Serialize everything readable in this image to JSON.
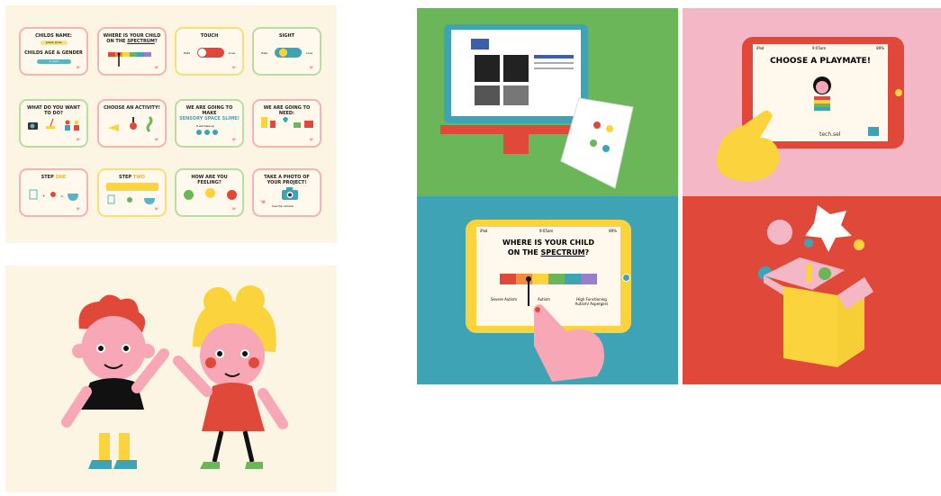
{
  "wireframe": {
    "cards": [
      {
        "title": "CHILDS NAME:",
        "subtitle": "CHILDS AGE & GENDER",
        "field1": "Jessie Jones",
        "field2": "4 years"
      },
      {
        "title_line1": "WHERE IS YOUR CHILD",
        "title_line2_prefix": "ON THE ",
        "title_line2_highlight": "SPECTRUM",
        "title_line2_suffix": "?"
      },
      {
        "title": "TOUCH",
        "left": "Hate",
        "right": "Love"
      },
      {
        "title": "SIGHT",
        "left": "Hate",
        "right": "Love"
      },
      {
        "title": "WHAT DO YOU WANT TO DO?"
      },
      {
        "title": "CHOOSE AN ACTIVITY!"
      },
      {
        "title_line1": "WE ARE GOING TO MAKE",
        "title_line2": "SENSORY SPACE SLIME!",
        "note": "It will take up"
      },
      {
        "title": "WE ARE GOING TO NEED:"
      },
      {
        "title_prefix": "STEP ",
        "title_highlight": "ONE"
      },
      {
        "title_prefix": "STEP ",
        "title_highlight": "TWO"
      },
      {
        "title": "HOW ARE YOU FEELING?",
        "faces": [
          "happy",
          "ok",
          "sad"
        ]
      },
      {
        "title_line1": "TAKE A PHOTO OF",
        "title_line2": "YOUR PROJECT!",
        "note": "Use the camera"
      }
    ]
  },
  "tablet_playmate": {
    "device": "iPad",
    "time": "9:05am",
    "battery": "89%",
    "title": "CHOOSE A PLAYMATE!",
    "brand": "tech.sel"
  },
  "tablet_spectrum": {
    "device": "iPad",
    "time": "9:05am",
    "battery": "89%",
    "title_line1": "WHERE IS YOUR CHILD",
    "title_line2_prefix": "ON THE ",
    "title_line2_highlight": "SPECTRUM",
    "title_line2_suffix": "?",
    "scale_left": "Severe Autism",
    "scale_mid": "Autism",
    "scale_right": "High Functioning Autism/ Aspergers"
  },
  "colors": {
    "green": "#6ab659",
    "pink": "#f4b7c5",
    "teal": "#3fa3b6",
    "red": "#e0493a",
    "yellow": "#fbd33d",
    "cream": "#fdf5e4"
  }
}
